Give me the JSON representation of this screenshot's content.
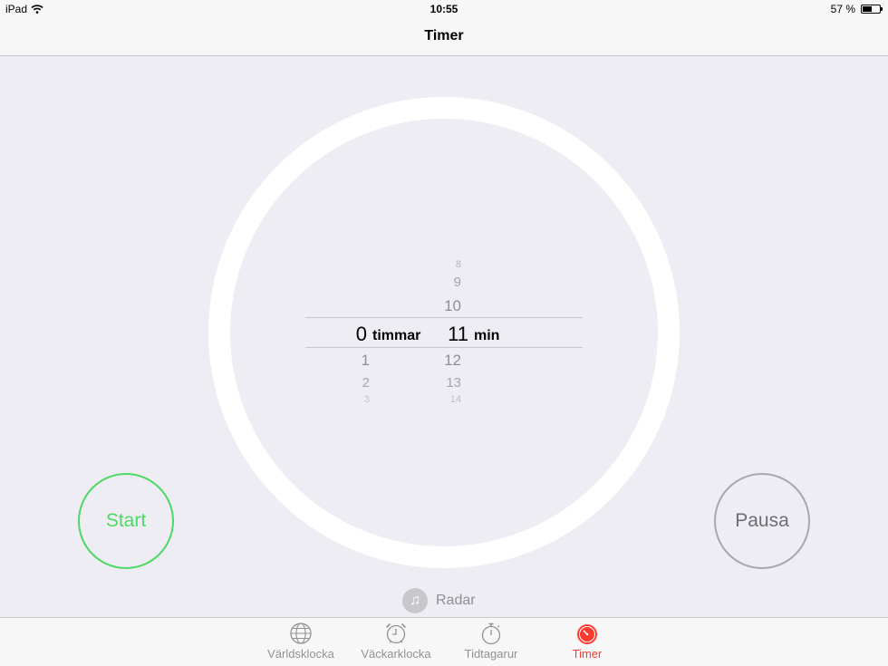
{
  "status_bar": {
    "device": "iPad",
    "time": "10:55",
    "battery": "57 %",
    "battery_level": 0.57
  },
  "nav": {
    "title": "Timer"
  },
  "picker": {
    "hours_above": [],
    "hours_selected": "0",
    "hours_unit": "timmar",
    "hours_below": [
      "1",
      "2",
      "3"
    ],
    "minutes_above": [
      "8",
      "9",
      "10"
    ],
    "minutes_selected": "11",
    "minutes_unit": "min",
    "minutes_below": [
      "12",
      "13",
      "14"
    ]
  },
  "buttons": {
    "start": "Start",
    "pause": "Pausa"
  },
  "sound": {
    "label": "Radar",
    "icon": "music-note-icon"
  },
  "tabs": [
    {
      "label": "Världsklocka",
      "icon": "globe-icon",
      "active": false
    },
    {
      "label": "Väckarklocka",
      "icon": "alarm-clock-icon",
      "active": false
    },
    {
      "label": "Tidtagarur",
      "icon": "stopwatch-icon",
      "active": false
    },
    {
      "label": "Timer",
      "icon": "timer-icon",
      "active": true
    }
  ],
  "colors": {
    "accent_green": "#4cd964",
    "accent_red": "#ff3b30",
    "background": "#efedf4"
  }
}
